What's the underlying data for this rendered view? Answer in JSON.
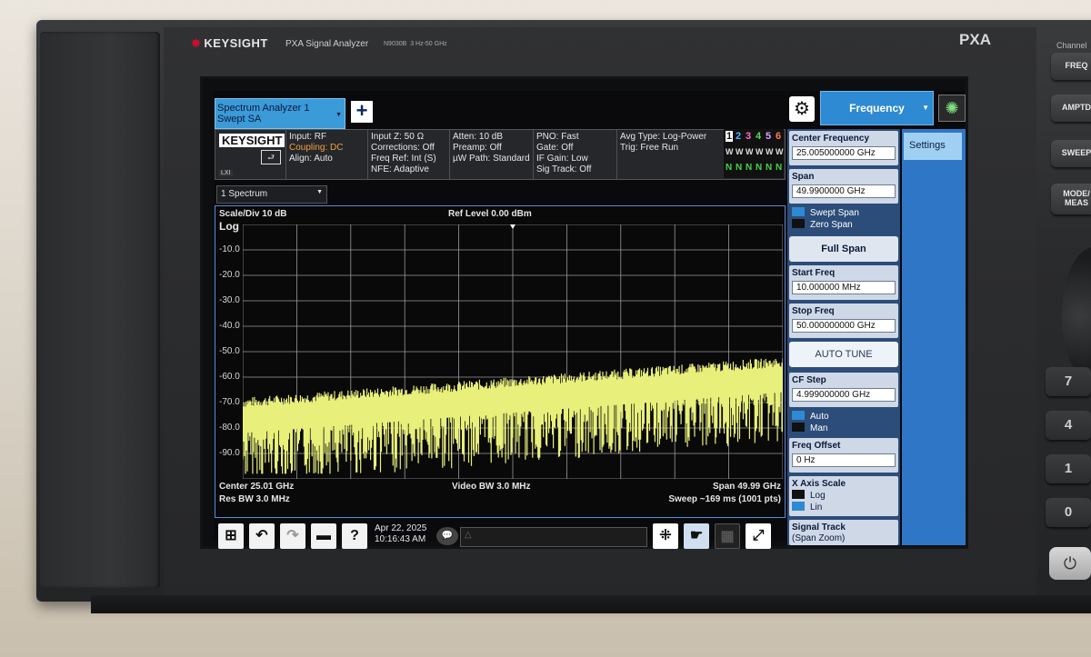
{
  "device": {
    "brand": "KEYSIGHT",
    "model": "PXA Signal Analyzer",
    "model_number": "N9030B",
    "freq_range": "3 Hz-50 GHz",
    "series_badge": "PXA",
    "channel_label": "Channel",
    "hard_keys": [
      "FREQ",
      "AMPTD",
      "SWEEP",
      "MODE/\nMEAS"
    ],
    "numpad": [
      "7",
      "4",
      "1",
      "0"
    ],
    "power_icon": "power-icon"
  },
  "mode_tab": {
    "line1": "Spectrum Analyzer 1",
    "line2": "Swept SA"
  },
  "freq_tab": {
    "label": "Frequency"
  },
  "info_panel": {
    "logo": "KEYSIGHT",
    "lxi": "LXI",
    "col1": [
      "Input: RF",
      "Coupling: DC",
      "Align: Auto"
    ],
    "col2": [
      "Input Z: 50 Ω",
      "Corrections: Off",
      "Freq Ref: Int (S)",
      "NFE: Adaptive"
    ],
    "col3": [
      "Atten: 10 dB",
      "Preamp: Off",
      "µW Path: Standard"
    ],
    "col4": [
      "PNO: Fast",
      "Gate: Off",
      "IF Gain: Low",
      "Sig Track: Off"
    ],
    "col5": [
      "Avg Type: Log-Power",
      "Trig: Free Run"
    ],
    "traces": {
      "numbers": [
        "1",
        "2",
        "3",
        "4",
        "5",
        "6"
      ],
      "number_colors": [
        "#f3f36a",
        "#4fb3ff",
        "#ff6fd0",
        "#5ad85a",
        "#d9a7ff",
        "#ff7a4a"
      ],
      "types": [
        "W",
        "W",
        "W",
        "W",
        "W",
        "W"
      ],
      "detectors": [
        "N",
        "N",
        "N",
        "N",
        "N",
        "N"
      ]
    }
  },
  "graph": {
    "window_name": "1 Spectrum",
    "scale": "Scale/Div 10 dB",
    "scale_type": "Log",
    "ref_level": "Ref Level 0.00 dBm",
    "y_ticks": [
      "-10.0",
      "-20.0",
      "-30.0",
      "-40.0",
      "-50.0",
      "-60.0",
      "-70.0",
      "-80.0",
      "-90.0"
    ],
    "center": "Center 25.01 GHz",
    "rbw": "Res BW 3.0 MHz",
    "vbw": "Video BW 3.0 MHz",
    "span": "Span 49.99 GHz",
    "sweep": "Sweep ~169 ms (1001 pts)",
    "trace_color": "#e8ef7a",
    "noise_floor_dbm": {
      "start": -72,
      "end": -56
    }
  },
  "taskbar": {
    "date": "Apr 22, 2025",
    "time": "10:16:43 AM"
  },
  "menu": {
    "settings_tab": "Settings",
    "center_freq": {
      "label": "Center Frequency",
      "value": "25.005000000 GHz"
    },
    "span": {
      "label": "Span",
      "value": "49.9900000 GHz"
    },
    "swept_span": "Swept Span",
    "zero_span": "Zero Span",
    "full_span": "Full Span",
    "start_freq": {
      "label": "Start Freq",
      "value": "10.000000 MHz"
    },
    "stop_freq": {
      "label": "Stop Freq",
      "value": "50.000000000 GHz"
    },
    "auto_tune": "AUTO TUNE",
    "cf_step": {
      "label": "CF Step",
      "value": "4.999000000 GHz"
    },
    "cf_auto": "Auto",
    "cf_man": "Man",
    "freq_offset": {
      "label": "Freq Offset",
      "value": "0 Hz"
    },
    "x_axis_scale": "X Axis Scale",
    "x_log": "Log",
    "x_lin": "Lin",
    "signal_track": "Signal Track",
    "span_zoom": "(Span Zoom)"
  }
}
